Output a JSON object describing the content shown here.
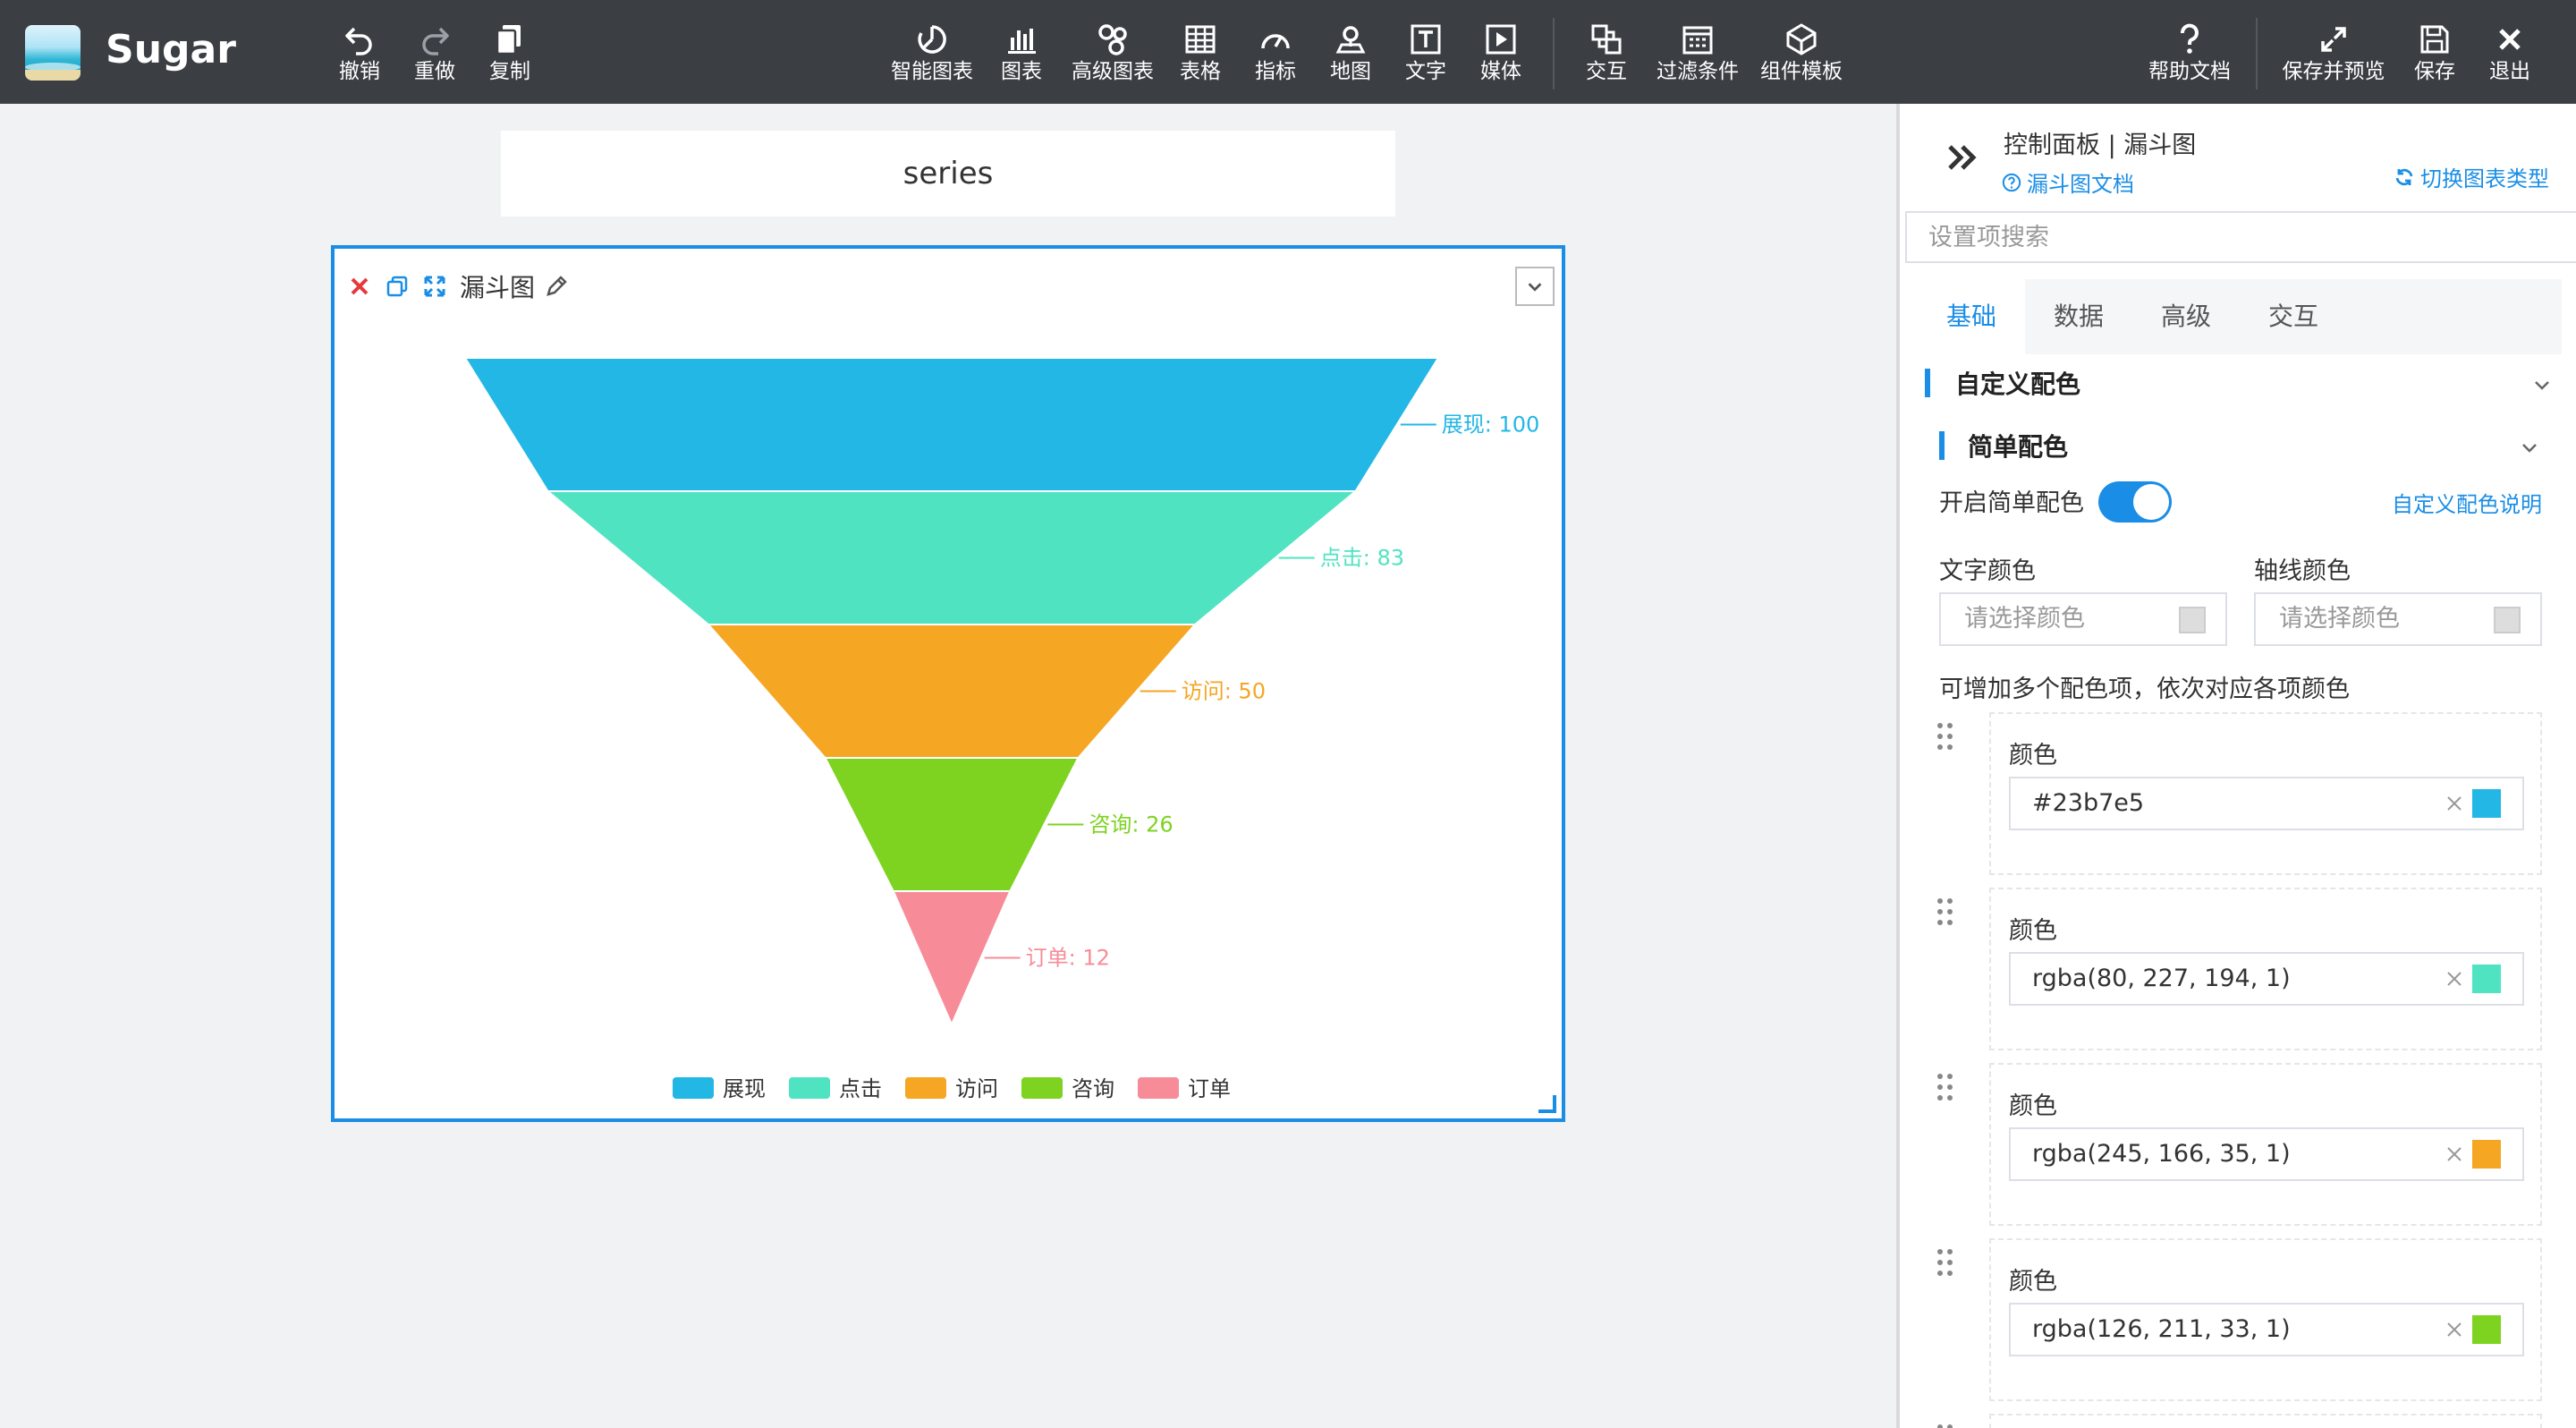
{
  "app": {
    "name": "Sugar"
  },
  "toolbar": {
    "undo": "撤销",
    "redo": "重做",
    "copy": "复制",
    "smart_chart": "智能图表",
    "chart": "图表",
    "adv_chart": "高级图表",
    "table": "表格",
    "metric": "指标",
    "map": "地图",
    "text": "文字",
    "media": "媒体",
    "interaction": "交互",
    "filter": "过滤条件",
    "template": "组件模板",
    "help": "帮助文档",
    "save_preview": "保存并预览",
    "save": "保存",
    "exit": "退出"
  },
  "canvas": {
    "title_text": "series",
    "card_name": "漏斗图"
  },
  "chart_data": {
    "type": "funnel",
    "categories": [
      "展现",
      "点击",
      "访问",
      "咨询",
      "订单"
    ],
    "values": [
      100,
      83,
      50,
      26,
      12
    ],
    "labels": [
      "展现: 100",
      "点击: 83",
      "访问: 50",
      "咨询: 26",
      "订单: 12"
    ],
    "colors": [
      "#23b7e5",
      "#50e3c2",
      "#f5a623",
      "#7ed321",
      "#f78c98"
    ],
    "legend_position": "bottom"
  },
  "panel": {
    "title": "控制面板 | 漏斗图",
    "doc_link": "漏斗图文档",
    "switch_link": "切换图表类型",
    "search_placeholder": "设置项搜索",
    "tabs": [
      "基础",
      "数据",
      "高级",
      "交互"
    ],
    "section_custom_color": "自定义配色",
    "section_simple_color": "简单配色",
    "enable_simple_color": "开启简单配色",
    "custom_color_help": "自定义配色说明",
    "text_color_label": "文字颜色",
    "axis_color_label": "轴线颜色",
    "color_placeholder": "请选择颜色",
    "multi_color_hint": "可增加多个配色项，依次对应各项颜色",
    "color_items": [
      {
        "label": "颜色",
        "value": "#23b7e5",
        "swatch": "#23b7e5"
      },
      {
        "label": "颜色",
        "value": "rgba(80, 227, 194, 1)",
        "swatch": "#50e3c2"
      },
      {
        "label": "颜色",
        "value": "rgba(245, 166, 35, 1)",
        "swatch": "#f5a623"
      },
      {
        "label": "颜色",
        "value": "rgba(126, 211, 33, 1)",
        "swatch": "#7ed321"
      }
    ]
  }
}
